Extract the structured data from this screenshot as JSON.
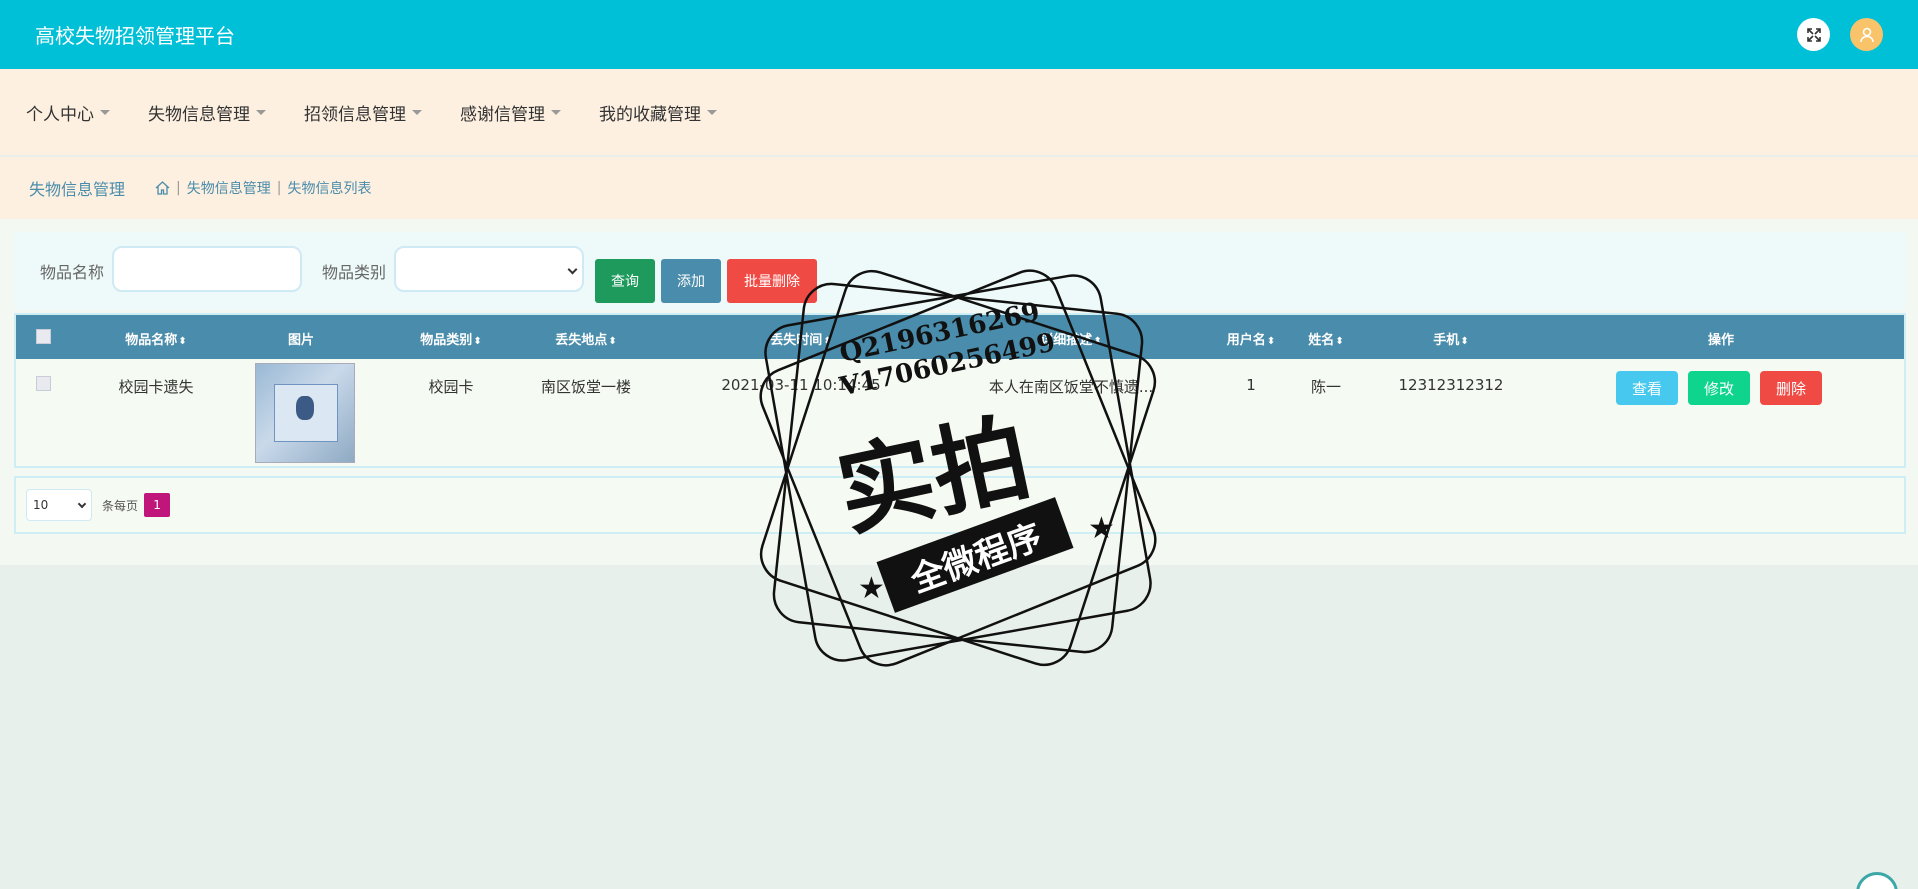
{
  "header": {
    "title": "高校失物招领管理平台",
    "expand_icon": "expand-icon",
    "user_icon": "user-icon"
  },
  "nav": {
    "items": [
      {
        "label": "个人中心"
      },
      {
        "label": "失物信息管理"
      },
      {
        "label": "招领信息管理"
      },
      {
        "label": "感谢信管理"
      },
      {
        "label": "我的收藏管理"
      }
    ]
  },
  "breadcrumb": {
    "title": "失物信息管理",
    "home_icon": "home-icon",
    "crumbs": [
      "失物信息管理",
      "失物信息列表"
    ]
  },
  "search": {
    "name_label": "物品名称",
    "name_value": "",
    "category_label": "物品类别",
    "category_value": "",
    "search_button": "查询",
    "add_button": "添加",
    "batch_delete_button": "批量删除"
  },
  "table": {
    "headers": [
      "物品名称",
      "图片",
      "物品类别",
      "丢失地点",
      "丢失时间",
      "详细描述",
      "用户名",
      "姓名",
      "手机",
      "操作"
    ],
    "rows": [
      {
        "name": "校园卡遗失",
        "category": "校园卡",
        "location": "南区饭堂一楼",
        "time": "2021-03-11 10:14:45",
        "description": "本人在南区饭堂不慎遗...",
        "username": "1",
        "realname": "陈一",
        "phone": "12312312312",
        "actions": {
          "view": "查看",
          "edit": "修改",
          "delete": "删除"
        }
      }
    ]
  },
  "pager": {
    "page_size": "10",
    "per_page_label": "条每页",
    "current_page": "1"
  },
  "watermark": {
    "line1": "Q2196316269",
    "line2": "V17060256499",
    "big": "实拍",
    "ribbon": "全微程序"
  },
  "colors": {
    "header_bg": "#00c0d8",
    "nav_bg": "#fdf0e1",
    "table_header": "#4a8cab",
    "danger": "#f04a45",
    "success": "#1e9b5c",
    "info": "#46c8ef",
    "edit": "#0fd48e",
    "page_active": "#c0157a"
  }
}
